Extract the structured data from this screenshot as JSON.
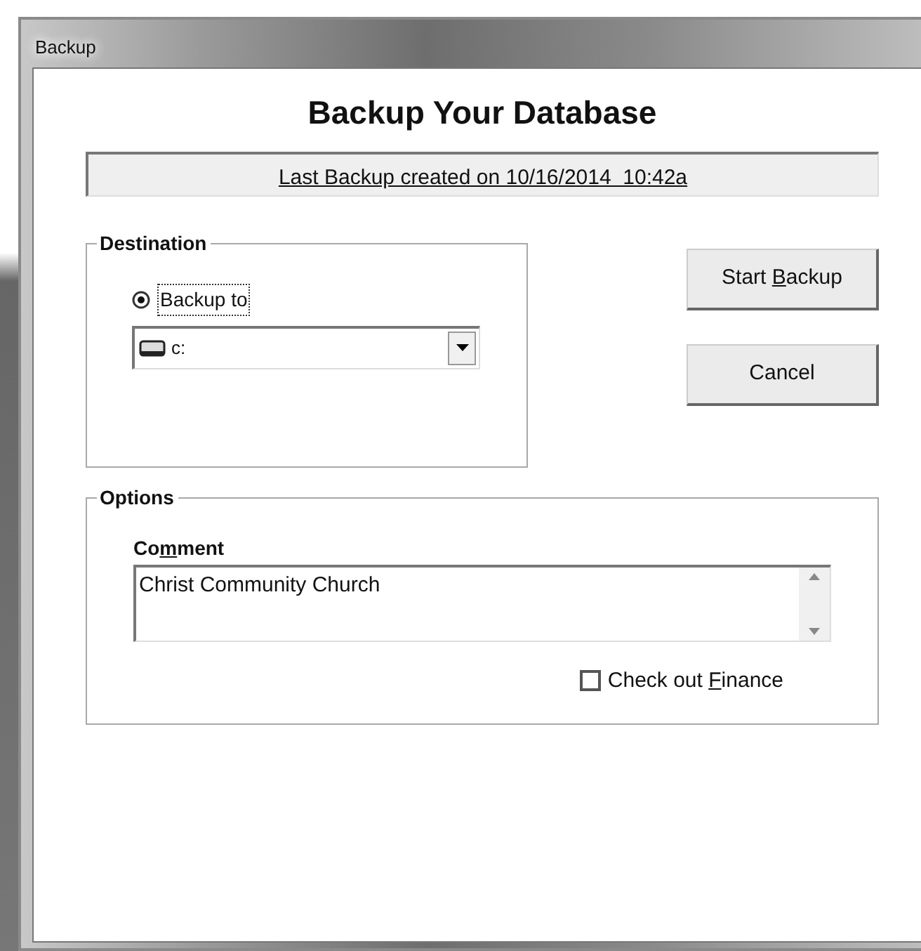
{
  "window": {
    "title": "Backup"
  },
  "heading": "Backup Your Database",
  "last_backup": "Last Backup created on 10/16/2014  10:42a",
  "destination": {
    "legend": "Destination",
    "radio": {
      "label": "Backup to",
      "selected": true,
      "focused": true
    },
    "drive_select": {
      "value": "c:"
    }
  },
  "buttons": [
    {
      "before": "Start ",
      "key": "B",
      "after": "ackup"
    },
    {
      "before": "Cancel"
    }
  ],
  "options": {
    "legend": "Options",
    "comment": {
      "label": {
        "before": "Co",
        "key": "m",
        "after": "ment"
      },
      "value": "Christ Community Church"
    },
    "checkbox": {
      "label": {
        "before": "Check out ",
        "key": "F",
        "after": "inance"
      },
      "checked": false
    }
  }
}
